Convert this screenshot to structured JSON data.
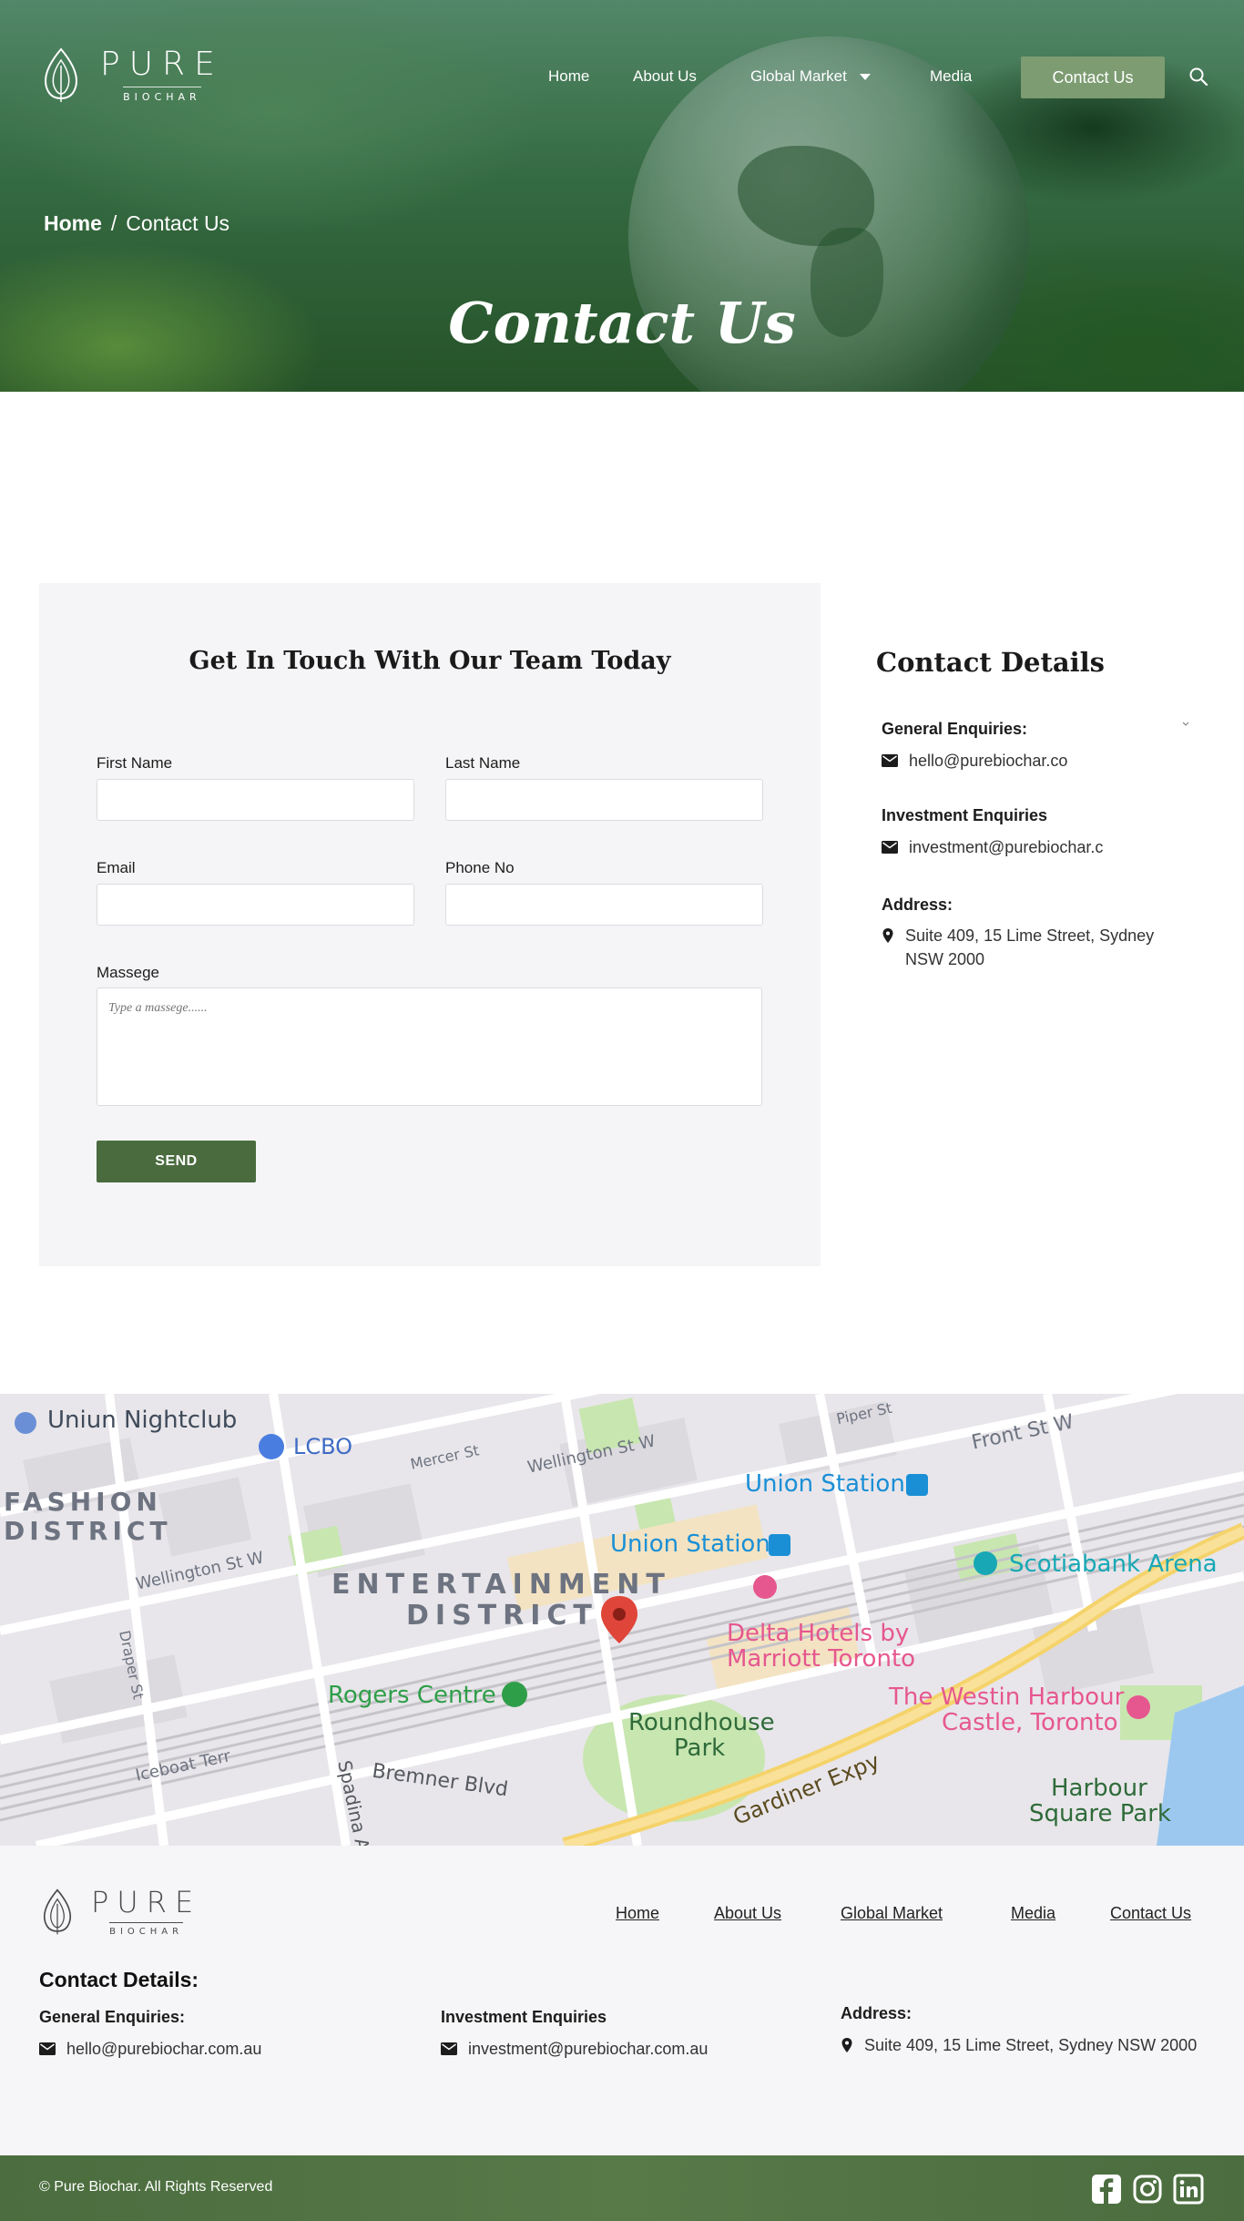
{
  "header": {
    "logo": {
      "word": "PURE",
      "sub": "BIOCHAR"
    },
    "nav": {
      "home": "Home",
      "about": "About Us",
      "global_market": "Global Market",
      "media": "Media",
      "contact_button": "Contact Us"
    }
  },
  "hero": {
    "breadcrumb": {
      "home": "Home",
      "separator": "/",
      "current": "Contact Us"
    },
    "title": "Contact Us"
  },
  "form": {
    "heading": "Get In Touch With Our Team Today",
    "first_name_label": "First Name",
    "first_name_value": "",
    "last_name_label": "Last Name",
    "last_name_value": "",
    "email_label": "Email",
    "email_value": "",
    "phone_label": "Phone No",
    "phone_value": "",
    "message_label": "Massege",
    "message_placeholder": "Type a massege......",
    "send_label": "SEND"
  },
  "contact_details": {
    "title": "Contact Details",
    "general_label": "General Enquiries:",
    "general_email": "hello@purebiochar.co",
    "investment_label": "Investment Enquiries",
    "investment_email": "investment@purebiochar.c",
    "address_label": "Address:",
    "address": "Suite 409, 15 Lime Street, Sydney NSW 2000"
  },
  "map": {
    "labels": {
      "uniun": "Uniun Nightclub",
      "lcbo": "LCBO",
      "fashion": "FASHION",
      "district1": "DISTRICT",
      "mercer": "Mercer St",
      "wellington_n": "Wellington St W",
      "piper": "Piper St",
      "front": "Front St W",
      "union1": "Union Station",
      "union2": "Union Station",
      "wellington_s": "Wellington St W",
      "entertainment": "ENTERTAINMENT",
      "district2": "DISTRICT",
      "scotiabank": "Scotiabank Arena",
      "delta1": "Delta Hotels by",
      "delta2": "Marriott Toronto",
      "draper": "Draper St",
      "rogers": "Rogers Centre",
      "westin1": "The Westin Harbour",
      "westin2": "Castle, Toronto",
      "roundhouse1": "Roundhouse",
      "roundhouse2": "Park",
      "iceboat": "Iceboat Terr",
      "bremner": "Bremner Blvd",
      "spadina": "Spadina A",
      "gardiner": "Gardiner Expy",
      "harbour1": "Harbour",
      "harbour2": "Square Park"
    }
  },
  "footer": {
    "logo": {
      "word": "PURE",
      "sub": "BIOCHAR"
    },
    "links": {
      "home": "Home",
      "about": "About Us",
      "global_market": "Global Market",
      "media": "Media",
      "contact": "Contact Us"
    },
    "heading": "Contact Details:",
    "general_label": "General Enquiries:",
    "general_email": "hello@purebiochar.com.au",
    "investment_label": "Investment Enquiries",
    "investment_email": "investment@purebiochar.com.au",
    "address_label": "Address:",
    "address": "Suite 409, 15 Lime Street, Sydney NSW 2000",
    "copyright": "© Pure Biochar. All Rights Reserved"
  },
  "colors": {
    "brand_green": "#4a6b3e",
    "cta_green": "#7d9c72",
    "footer_bar": "#4b6d3f",
    "map_red_pin": "#e0453a",
    "map_blue": "#1a8fd6",
    "map_pink": "#e6578f",
    "map_green": "#2f9e49"
  },
  "icons": [
    "leaf-logo-icon",
    "chevron-down-icon",
    "search-icon",
    "mail-icon",
    "location-pin-icon",
    "map-pin-icon",
    "facebook-icon",
    "instagram-icon",
    "linkedin-icon"
  ]
}
